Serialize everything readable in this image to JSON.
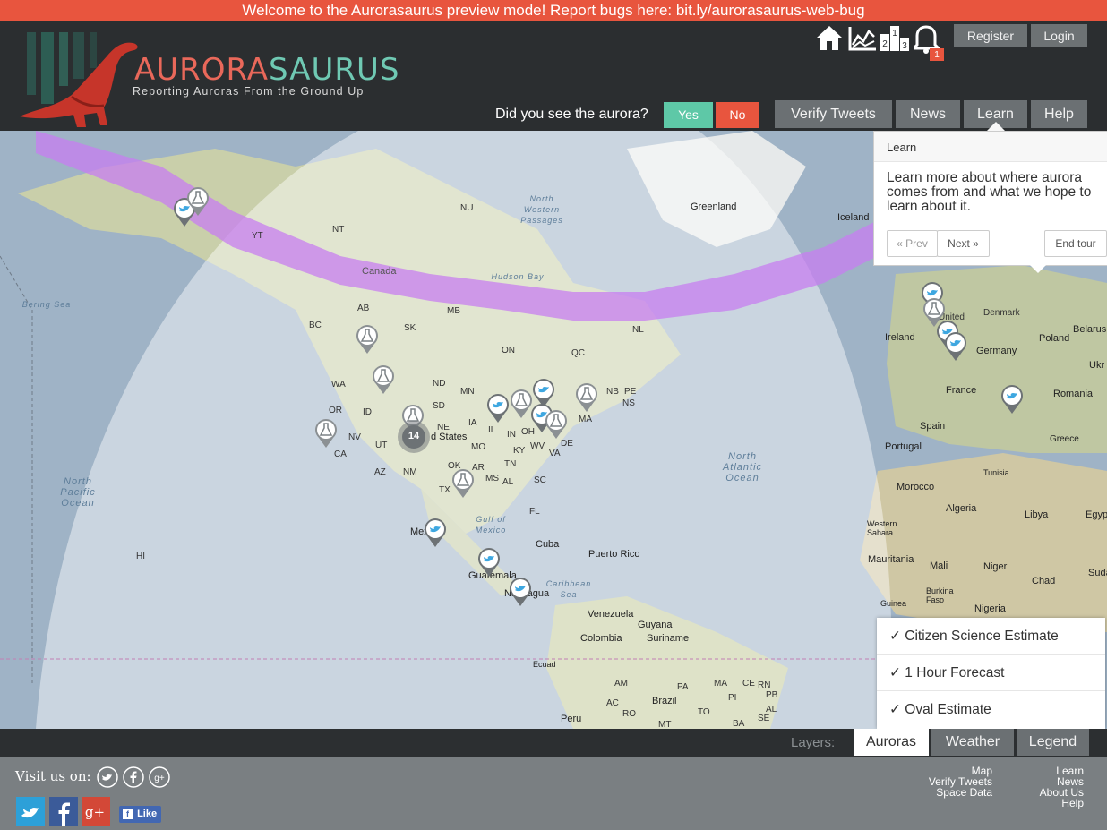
{
  "banner": {
    "text": "Welcome to the Aurorasaurus preview mode! Report bugs here: bit.ly/aurorasaurus-web-bug"
  },
  "logo": {
    "word_a": "AURORA",
    "word_b": "SAURUS",
    "tagline": "Reporting Auroras From the Ground Up"
  },
  "header": {
    "register_label": "Register",
    "login_label": "Login",
    "notification_count": "1",
    "leaderboard_digits": [
      "2",
      "1",
      "3"
    ],
    "question": "Did you see the aurora?",
    "yes_label": "Yes",
    "no_label": "No",
    "nav": [
      "Verify Tweets",
      "News",
      "Learn",
      "Help"
    ]
  },
  "popover": {
    "title": "Learn",
    "body": "Learn more about where aurora comes from and what we hope to learn about it.",
    "prev_label": "« Prev",
    "next_label": "Next »",
    "end_label": "End tour"
  },
  "map": {
    "cluster_count": "14",
    "oceans": [
      "North Pacific Ocean",
      "North Atlantic Ocean",
      "Bering Sea",
      "Gulf of Mexico",
      "Caribbean Sea",
      "North Western Passages",
      "Hudson Bay"
    ],
    "places": [
      "Greenland",
      "Iceland",
      "Canada",
      "NU",
      "NT",
      "YT",
      "BC",
      "AB",
      "SK",
      "MB",
      "ON",
      "QC",
      "NL",
      "NB",
      "PE",
      "NS",
      "WA",
      "OR",
      "CA",
      "ID",
      "NV",
      "UT",
      "AZ",
      "NM",
      "ND",
      "SD",
      "NE",
      "MN",
      "IA",
      "IL",
      "IN",
      "OH",
      "KY",
      "WV",
      "VA",
      "MO",
      "OK",
      "AR",
      "TN",
      "MS",
      "AL",
      "SC",
      "TX",
      "FL",
      "MA",
      "DE",
      "d States",
      "Mexico",
      "Cuba",
      "Puerto Rico",
      "Guatemala",
      "Nicaragua",
      "Venezuela",
      "Colombia",
      "Guyana",
      "Suriname",
      "Ecuad",
      "Brazil",
      "Peru",
      "HI",
      "Denmark",
      "Belarus",
      "Ireland",
      "Germany",
      "Poland",
      "Ukr",
      "France",
      "Romania",
      "Spain",
      "Greece",
      "Portugal",
      "Tunisia",
      "Morocco",
      "Algeria",
      "Libya",
      "Egypt",
      "Western Sahara",
      "Mauritania",
      "Mali",
      "Niger",
      "Chad",
      "Sudan",
      "Burkina Faso",
      "Guinea",
      "Nigeria",
      "AM",
      "PA",
      "MA",
      "CE",
      "RN",
      "PB",
      "PI",
      "TO",
      "AL",
      "SE",
      "BA",
      "RO",
      "MT",
      "AC",
      "United"
    ]
  },
  "layers_menu": [
    "✓ Citizen Science Estimate",
    "✓ 1 Hour Forecast",
    "✓ Oval Estimate"
  ],
  "layers_bar": {
    "label": "Layers:",
    "tabs": [
      "Auroras",
      "Weather",
      "Legend"
    ]
  },
  "footer": {
    "visit_label": "Visit us on:",
    "like_label": "Like",
    "col1": [
      "Map",
      "Verify Tweets",
      "Space Data"
    ],
    "col2": [
      "Learn",
      "News",
      "About Us",
      "Help"
    ]
  },
  "colors": {
    "banner": "#e8553e",
    "yes": "#5ec8a7",
    "no": "#e8553e",
    "aurora_band": "#c77df0",
    "header_bg": "#2b2e30"
  }
}
